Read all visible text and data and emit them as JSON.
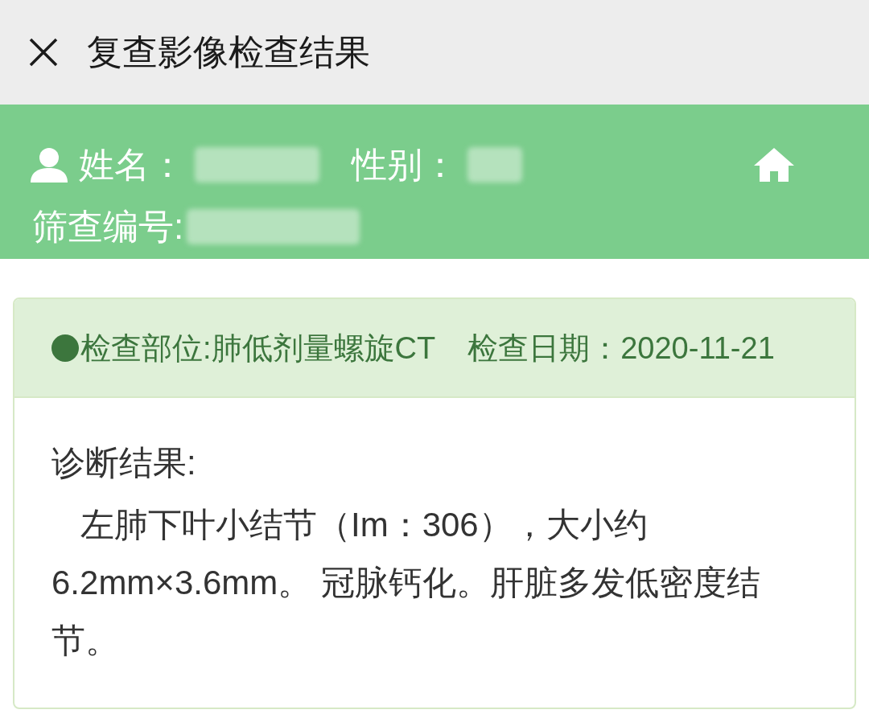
{
  "top_bar": {
    "title": "复查影像检查结果"
  },
  "patient": {
    "name_label": "姓名：",
    "gender_label": "性别：",
    "screening_no_label": "筛查编号:"
  },
  "exam": {
    "site": "检查部位:肺低剂量螺旋CT",
    "date": "检查日期：2020-11-21",
    "diagnosis_label": "诊断结果:",
    "diagnosis": "左肺下叶小结节（Im：306），大小约6.2mm×3.6mm。 冠脉钙化。肝脏多发低密度结节。"
  }
}
